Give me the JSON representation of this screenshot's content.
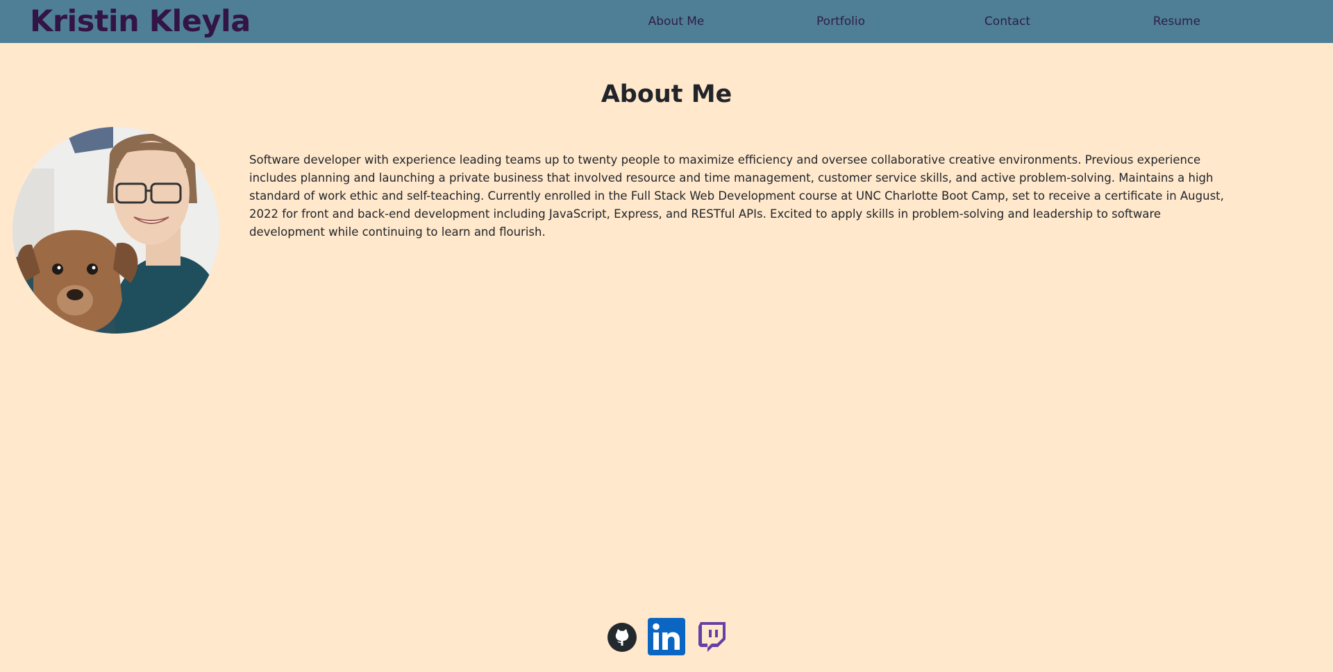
{
  "header": {
    "brand": "Kristin Kleyla",
    "nav": [
      {
        "label": "About Me"
      },
      {
        "label": "Portfolio"
      },
      {
        "label": "Contact"
      },
      {
        "label": "Resume"
      }
    ]
  },
  "main": {
    "title": "About Me",
    "bio": "Software developer with experience leading teams up to twenty people to maximize efficiency and oversee collaborative creative environments. Previous experience includes planning and launching a private business that involved resource and time management, customer service skills, and active problem-solving. Maintains a high standard of work ethic and self-teaching. Currently enrolled in the Full Stack Web Development course at UNC Charlotte Boot Camp, set to receive a certificate in August, 2022 for front and back-end development including JavaScript, Express, and RESTful APIs. Excited to apply skills in problem-solving and leadership to software development while continuing to learn and flourish."
  },
  "footer": {
    "socials": [
      {
        "icon": "github-icon"
      },
      {
        "icon": "linkedin-icon"
      },
      {
        "icon": "twitch-icon"
      }
    ]
  },
  "colors": {
    "background": "#FFE8CC",
    "navbar": "#4F7F97",
    "brand": "#321445",
    "linkedin": "#0A66C2",
    "twitch": "#6441A5"
  }
}
